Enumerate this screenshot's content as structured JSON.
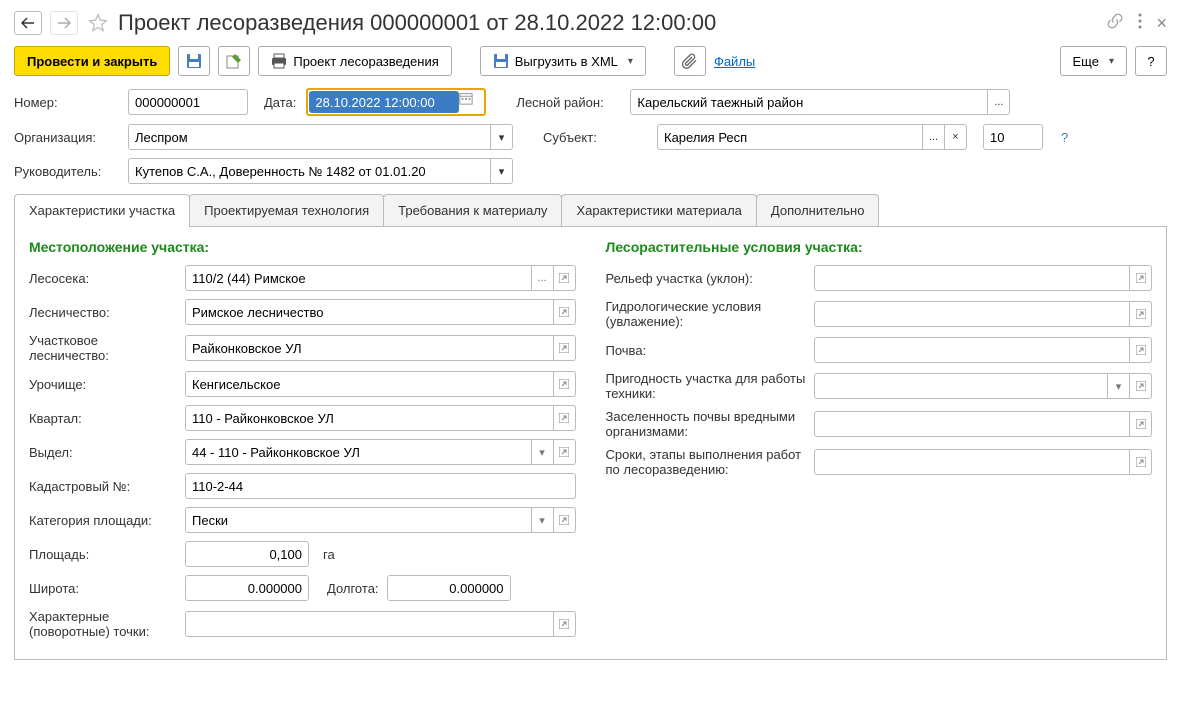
{
  "header": {
    "title": "Проект лесоразведения 000000001 от 28.10.2022 12:00:00"
  },
  "toolbar": {
    "post_close": "Провести и закрыть",
    "project": "Проект лесоразведения",
    "export_xml": "Выгрузить в XML",
    "files_link": "Файлы",
    "more": "Еще",
    "help": "?"
  },
  "form": {
    "number_label": "Номер:",
    "number_value": "000000001",
    "date_label": "Дата:",
    "date_value": "28.10.2022 12:00:00",
    "region_label": "Лесной район:",
    "region_value": "Карельский таежный район",
    "org_label": "Организация:",
    "org_value": "Леспром",
    "subject_label": "Субъект:",
    "subject_value": "Карелия Респ",
    "subject_code": "10",
    "manager_label": "Руководитель:",
    "manager_value": "Кутепов С.А., Доверенность № 1482 от 01.01.20"
  },
  "tabs": {
    "t1": "Характеристики участка",
    "t2": "Проектируемая технология",
    "t3": "Требования к материалу",
    "t4": "Характеристики материала",
    "t5": "Дополнительно"
  },
  "location": {
    "section_title": "Местоположение участка:",
    "lesoseka_lbl": "Лесосека:",
    "lesoseka_val": "110/2 (44) Римское",
    "lesnichestvo_lbl": "Лесничество:",
    "lesnichestvo_val": "Римское лесничество",
    "uch_les_lbl": "Участковое лесничество:",
    "uch_les_val": "Райконковское УЛ",
    "urochishe_lbl": "Урочище:",
    "urochishe_val": "Кенгисельское",
    "kvartal_lbl": "Квартал:",
    "kvartal_val": "110 - Райконковское УЛ",
    "vydel_lbl": "Выдел:",
    "vydel_val": "44 - 110 - Райконковское УЛ",
    "kadastr_lbl": "Кадастровый №:",
    "kadastr_val": "110-2-44",
    "category_lbl": "Категория площади:",
    "category_val": "Пески",
    "area_lbl": "Площадь:",
    "area_val": "0,100",
    "area_unit": "га",
    "lat_lbl": "Широта:",
    "lat_val": "0.000000",
    "lon_lbl": "Долгота:",
    "lon_val": "0.000000",
    "points_lbl": "Характерные (поворотные) точки:",
    "points_val": ""
  },
  "conditions": {
    "section_title": "Лесорастительные условия участка:",
    "relief_lbl": "Рельеф участка (уклон):",
    "hydro_lbl": "Гидрологические условия (увлажение):",
    "soil_lbl": "Почва:",
    "suitability_lbl": "Пригодность участка для работы техники:",
    "pests_lbl": "Заселенность почвы вредными организмами:",
    "timing_lbl": "Сроки, этапы выполнения работ по лесоразведению:"
  },
  "icons": {
    "ellipsis": "...",
    "clear": "×",
    "help": "?",
    "dropdown": "▾"
  }
}
